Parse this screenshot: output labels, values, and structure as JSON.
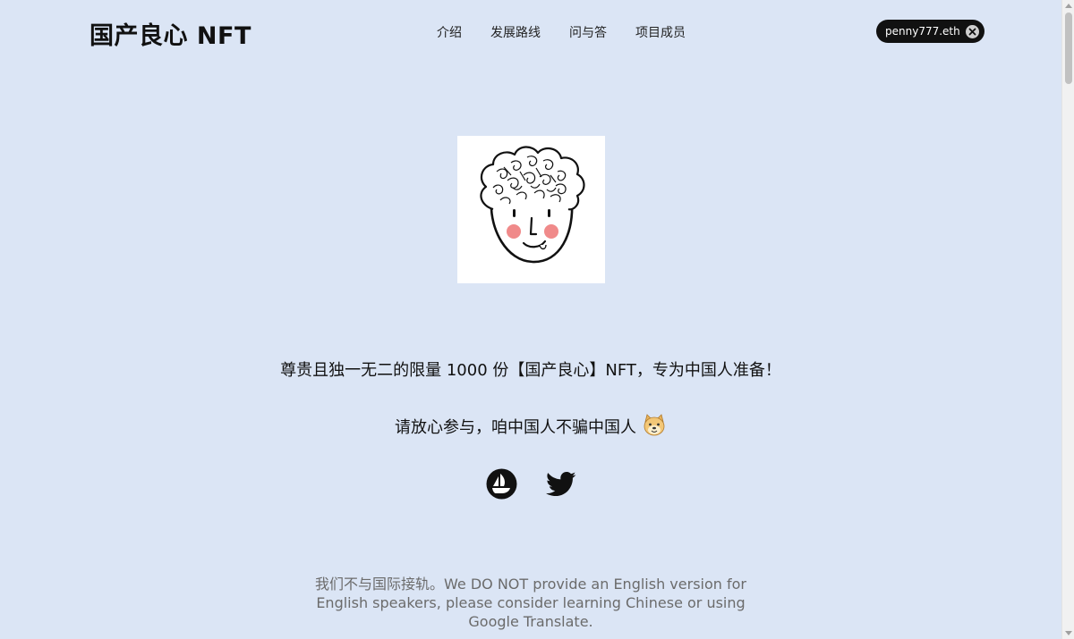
{
  "header": {
    "logo": "国产良心 NFT",
    "nav": [
      {
        "label": "介绍"
      },
      {
        "label": "发展路线"
      },
      {
        "label": "问与答"
      },
      {
        "label": "项目成员"
      }
    ],
    "wallet": {
      "address": "penny777.eth",
      "disconnect_icon": "close-circle-icon"
    }
  },
  "hero": {
    "image_icon": "nft-face-illustration",
    "tagline_1": "尊贵且独一无二的限量 1000 份【国产良心】NFT，专为中国人准备！",
    "tagline_2": "请放心参与，咱中国人不骗中国人",
    "tagline_2_emoji": "doge-emoji"
  },
  "socials": [
    {
      "name": "opensea",
      "icon": "opensea-icon"
    },
    {
      "name": "twitter",
      "icon": "twitter-icon"
    }
  ],
  "footer": {
    "disclaimer": "我们不与国际接轨。We DO NOT provide an English version for English speakers, please consider learning Chinese or using Google Translate."
  },
  "colors": {
    "background": "#dbe5f5",
    "text": "#111111",
    "muted_text": "#6b6b6b",
    "wallet_bg": "#111111",
    "blush": "#f08a8a"
  }
}
